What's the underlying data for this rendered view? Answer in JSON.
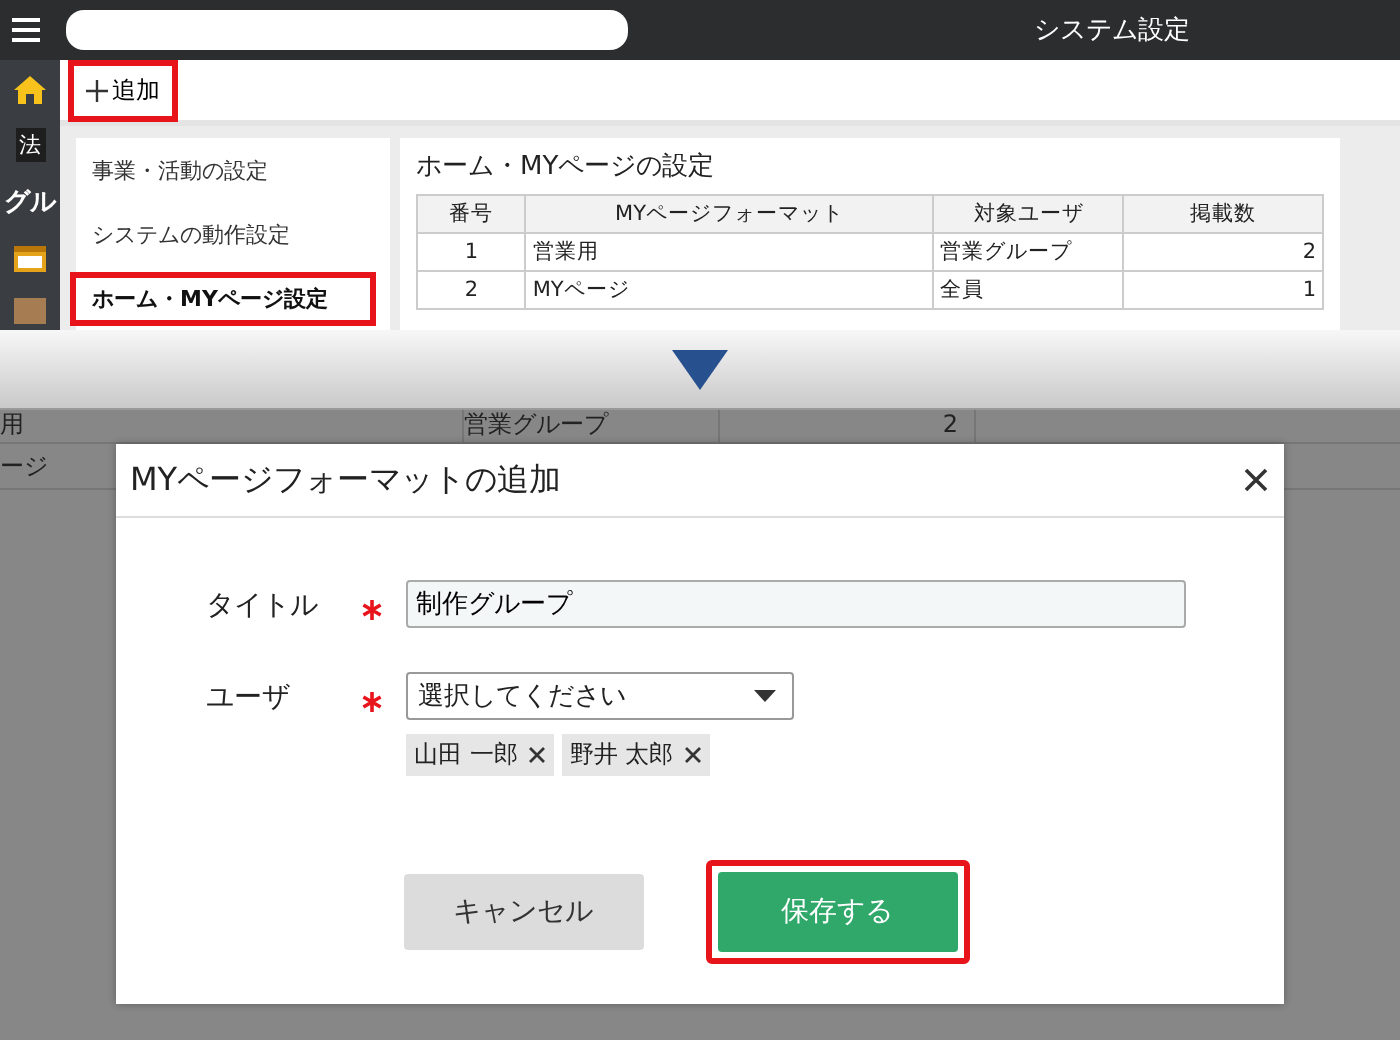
{
  "header": {
    "title": "システム設定"
  },
  "sidebar": {
    "items": [
      {
        "kind": "home"
      },
      {
        "kind": "tag",
        "label": "法"
      },
      {
        "kind": "text",
        "label": "グル"
      },
      {
        "kind": "calendar"
      },
      {
        "kind": "box"
      }
    ]
  },
  "toolbar": {
    "add_button": {
      "label": "追加",
      "highlighted": true
    }
  },
  "settings_menu": {
    "items": [
      {
        "label": "事業・活動の設定",
        "selected": false,
        "highlighted": false
      },
      {
        "label": "システムの動作設定",
        "selected": false,
        "highlighted": false
      },
      {
        "label": "ホーム・MYページ設定",
        "selected": true,
        "highlighted": true
      }
    ]
  },
  "panel": {
    "title": "ホーム・MYページの設定",
    "table": {
      "columns": [
        "番号",
        "MYページフォーマット",
        "対象ユーザ",
        "掲載数"
      ],
      "rows": [
        [
          "1",
          "営業用",
          "営業グループ",
          "2"
        ],
        [
          "2",
          "MYページ",
          "全員",
          "1"
        ]
      ]
    }
  },
  "background_table": {
    "rows": [
      {
        "cells": [
          "用",
          "営業グループ",
          "2"
        ]
      },
      {
        "cells": [
          "ージ"
        ]
      }
    ]
  },
  "dialog": {
    "title": "MYページフォーマットの追加",
    "fields": [
      {
        "kind": "text",
        "label": "タイトル",
        "required": true,
        "value": "制作グループ"
      },
      {
        "kind": "select",
        "label": "ユーザ",
        "required": true,
        "value": "選択してください",
        "chips": [
          "山田 一郎",
          "野井 太郎"
        ]
      }
    ],
    "buttons": [
      {
        "kind": "secondary",
        "label": "キャンセル",
        "highlighted": false
      },
      {
        "kind": "primary",
        "label": "保存する",
        "highlighted": true
      }
    ]
  }
}
